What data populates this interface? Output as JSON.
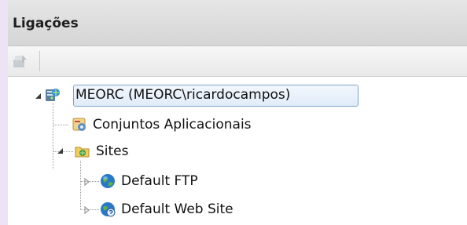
{
  "panel": {
    "title": "Ligações"
  },
  "toolbar": {
    "items": [
      "connect-icon"
    ]
  },
  "tree": {
    "root": {
      "label": "MEORC (MEORC\\ricardocampos)",
      "icon": "server-icon",
      "expanded": true,
      "selected": true
    },
    "app_pools": {
      "label": "Conjuntos Aplicacionais",
      "icon": "app-pools-icon"
    },
    "sites": {
      "label": "Sites",
      "icon": "sites-folder-icon",
      "expanded": true
    },
    "ftp": {
      "label": "Default FTP",
      "icon": "globe-icon",
      "expanded": false
    },
    "web": {
      "label": "Default Web Site",
      "icon": "globe-web-icon",
      "expanded": false
    }
  },
  "colors": {
    "header_bg": "#dcdcdc",
    "selection_border": "#7da2ce",
    "selection_bg": "#e8f0fb",
    "page_bg": "#ece4f4"
  }
}
